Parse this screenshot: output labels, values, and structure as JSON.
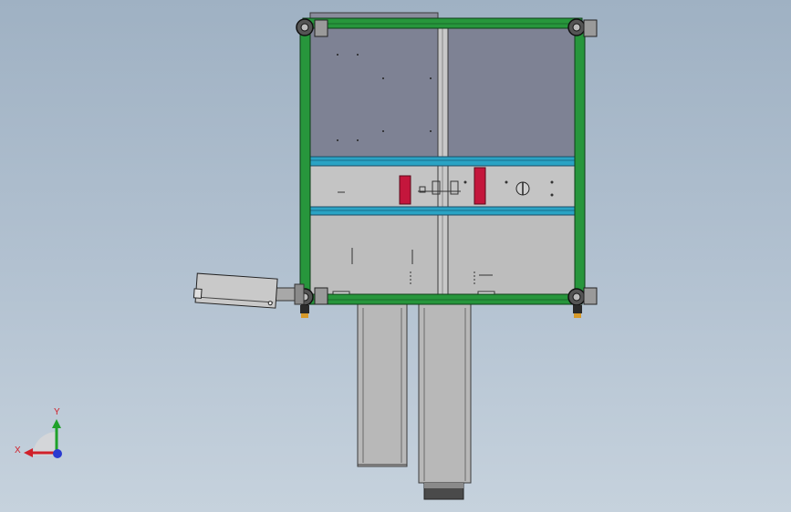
{
  "triad": {
    "x_label": "X",
    "y_label": "Y",
    "x_color": "#d0202a",
    "y_color": "#1fa12a",
    "z_color": "#2a3ad0"
  },
  "colors": {
    "background_top": "#9fb1c3",
    "background_bottom": "#c6d2dd",
    "frame_green": "#27963c",
    "beam_blue": "#2aa3c4",
    "post_red": "#c4163c",
    "panel_gray": "#b9b9b9",
    "panel_dark": "#7e8294"
  }
}
